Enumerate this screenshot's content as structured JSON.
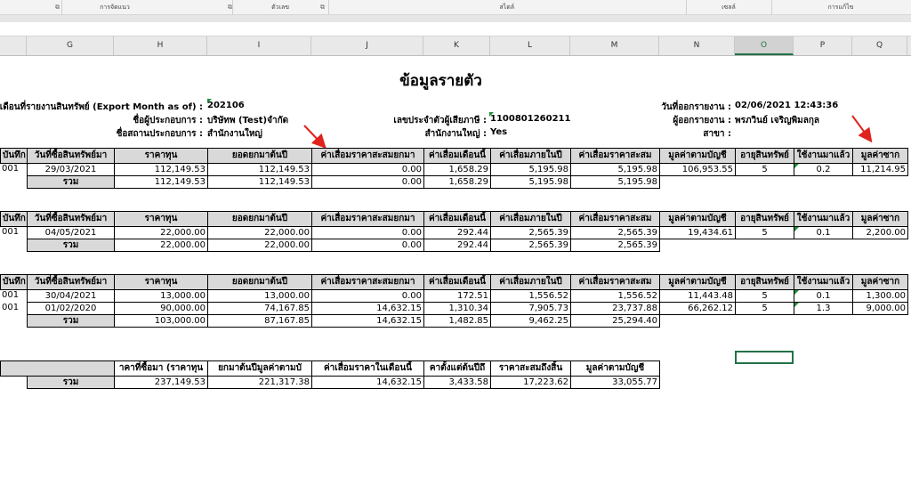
{
  "ribbon": {
    "groups": [
      "การจัดแนว",
      "ตัวเลข",
      "สไตล์",
      "เซลล์",
      "การแก้ไข"
    ]
  },
  "columns": [
    "G",
    "H",
    "I",
    "J",
    "K",
    "L",
    "M",
    "N",
    "O",
    "P",
    "Q"
  ],
  "selected_column": "O",
  "title": "ข้อมูลรายตัว",
  "info": {
    "export_month_label": "เดือนที่รายงานสินทรัพย์ (Export Month as of) :",
    "export_month": "202106",
    "operator_label": "ชื่อผู้ประกอบการ :",
    "operator": "บริษัทพ (Test)จำกัด",
    "branch_name_label": "ชื่อสถานประกอบการ :",
    "branch_name": "สำนักงานใหญ่",
    "tax_id_label": "เลขประจำตัวผู้เสียภาษี :",
    "tax_id": "1100801260211",
    "head_office_label": "สำนักงานใหญ่ :",
    "head_office": "Yes",
    "report_date_label": "วันที่ออกรายงาน :",
    "report_date": "02/06/2021 12:43:36",
    "reporter_label": "ผู้ออกรายงาน :",
    "reporter": "พรภวินย์ เจริญพิมลกุล",
    "branch_label": "สาขา :",
    "branch": ""
  },
  "headers": [
    "บันทึก",
    "วันที่ซื้อสินทรัพย์มา",
    "ราคาทุน",
    "ยอดยกมาต้นปี",
    "ค่าเสื่อมราคาสะสมยกมา",
    "ค่าเสื่อมเดือนนี้",
    "ค่าเสื่อมภายในปี",
    "ค่าเสื่อมราคาสะสม",
    "มูลค่าตามบัญชี",
    "อายุสินทรัพย์",
    "ใช้งานมาแล้ว",
    "มูลค่าซาก"
  ],
  "total_label": "รวม",
  "tables": [
    {
      "rows": [
        [
          "001",
          "29/03/2021",
          "112,149.53",
          "112,149.53",
          "0.00",
          "1,658.29",
          "5,195.98",
          "5,195.98",
          "106,953.55",
          "5",
          "0.2",
          "11,214.95"
        ]
      ],
      "total": [
        "112,149.53",
        "112,149.53",
        "0.00",
        "1,658.29",
        "5,195.98",
        "5,195.98"
      ]
    },
    {
      "rows": [
        [
          "001",
          "04/05/2021",
          "22,000.00",
          "22,000.00",
          "0.00",
          "292.44",
          "2,565.39",
          "2,565.39",
          "19,434.61",
          "5",
          "0.1",
          "2,200.00"
        ]
      ],
      "total": [
        "22,000.00",
        "22,000.00",
        "0.00",
        "292.44",
        "2,565.39",
        "2,565.39"
      ]
    },
    {
      "rows": [
        [
          "001",
          "30/04/2021",
          "13,000.00",
          "13,000.00",
          "0.00",
          "172.51",
          "1,556.52",
          "1,556.52",
          "11,443.48",
          "5",
          "0.1",
          "1,300.00"
        ],
        [
          "001",
          "01/02/2020",
          "90,000.00",
          "74,167.85",
          "14,632.15",
          "1,310.34",
          "7,905.73",
          "23,737.88",
          "66,262.12",
          "5",
          "1.3",
          "9,000.00"
        ]
      ],
      "total": [
        "103,000.00",
        "87,167.85",
        "14,632.15",
        "1,482.85",
        "9,462.25",
        "25,294.40"
      ]
    }
  ],
  "summary": {
    "headers": [
      "าคาที่ซื้อมา (ราคาทุน",
      "ยกมาต้นปีมูลค่าตามบั",
      "ค่าเสื่อมราคาในเดือนนี้",
      "คาตั้งแต่ต้นปีถึ",
      "ราคาสะสมถึงสิ้น",
      "มูลค่าตามบัญชี"
    ],
    "total": [
      "237,149.53",
      "221,317.38",
      "14,632.15",
      "3,433.58",
      "17,223.62",
      "33,055.77"
    ]
  },
  "annotation_color": "#e0231c",
  "accent": "#217346"
}
